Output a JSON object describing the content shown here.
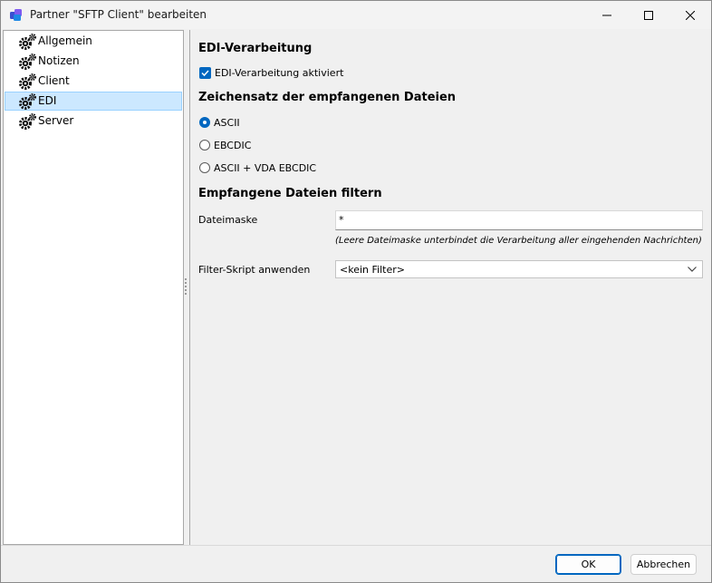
{
  "window": {
    "title": "Partner \"SFTP Client\" bearbeiten",
    "app_icon": "cubes-icon",
    "controls": [
      "minimize-icon",
      "maximize-icon",
      "close-icon"
    ]
  },
  "sidebar": {
    "items": [
      {
        "label": "Allgemein",
        "icon": "gears-icon",
        "selected": false
      },
      {
        "label": "Notizen",
        "icon": "gears-icon",
        "selected": false
      },
      {
        "label": "Client",
        "icon": "gears-icon",
        "selected": false
      },
      {
        "label": "EDI",
        "icon": "gears-icon",
        "selected": true
      },
      {
        "label": "Server",
        "icon": "gears-icon",
        "selected": false
      }
    ]
  },
  "content": {
    "section1_title": "EDI-Verarbeitung",
    "edi_checkbox": {
      "label": "EDI-Verarbeitung aktiviert",
      "checked": true
    },
    "section2_title": "Zeichensatz der empfangenen Dateien",
    "charset_options": [
      {
        "label": "ASCII",
        "selected": true
      },
      {
        "label": "EBCDIC",
        "selected": false
      },
      {
        "label": "ASCII + VDA EBCDIC",
        "selected": false
      }
    ],
    "section3_title": "Empfangene Dateien filtern",
    "file_mask": {
      "label": "Dateimaske",
      "value": "*"
    },
    "file_mask_hint": "(Leere Dateimaske unterbindet die Verarbeitung aller eingehenden Nachrichten)",
    "filter_script": {
      "label": "Filter-Skript anwenden",
      "value": "<kein Filter>"
    }
  },
  "footer": {
    "ok_label": "OK",
    "cancel_label": "Abbrechen"
  },
  "colors": {
    "accent": "#0067c0",
    "selection": "#cce8ff"
  }
}
